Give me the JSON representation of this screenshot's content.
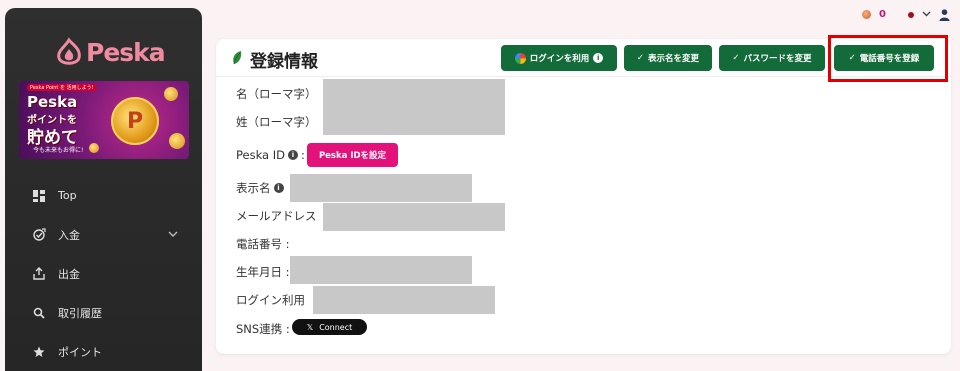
{
  "app": {
    "logo_text": "Peska"
  },
  "banner": {
    "top_small": "Peska Point を 活用しよう!",
    "line1": "Peska",
    "line2": "ポイントを",
    "line3": "貯めて",
    "line4": "今も未来もお得に!",
    "coin": "P"
  },
  "sidebar": {
    "items": [
      {
        "label": "Top",
        "icon": "dashboard-icon"
      },
      {
        "label": "入金",
        "icon": "deposit-icon",
        "has_chevron": true
      },
      {
        "label": "出金",
        "icon": "withdraw-icon"
      },
      {
        "label": "取引履歴",
        "icon": "search-icon"
      },
      {
        "label": "ポイント",
        "icon": "star-icon"
      }
    ]
  },
  "topbar": {
    "points": "0"
  },
  "card": {
    "title": "登録情報",
    "buttons": {
      "google_login": "ログインを利用",
      "change_display_name": "表示名を変更",
      "change_password": "パスワードを変更",
      "register_phone": "電話番号を登録"
    },
    "fields": {
      "name_roman": "名（ローマ字）",
      "surname_roman": "姓（ローマ字）",
      "peska_id": "Peska ID",
      "peska_id_sep": ":",
      "peska_id_button": "Peska IDを設定",
      "display_name": "表示名",
      "email": "メールアドレス",
      "phone": "電話番号 :",
      "birthday": "生年月日 :",
      "login_use": "ログイン利用",
      "sns": "SNS連携 :",
      "x_connect": "Connect",
      "x_logo": "𝕏"
    }
  },
  "colors": {
    "primary_green": "#136b3a",
    "peska_pink": "#e2127a",
    "highlight_red": "#e00000",
    "sidebar_bg": "#2b2b2b"
  }
}
